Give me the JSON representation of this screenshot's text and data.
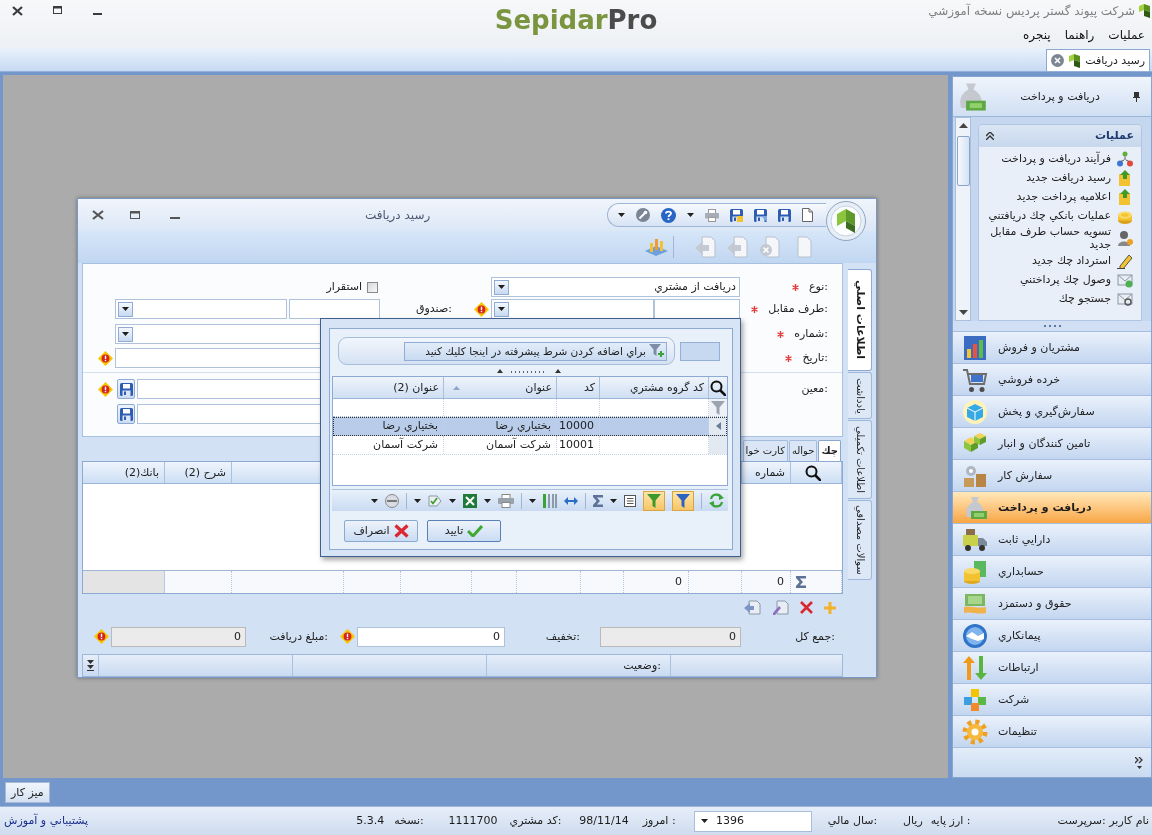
{
  "window": {
    "title": "شركت پيوند گستر پرديس نسخه آموزشي",
    "logo": {
      "text": "Sepidar",
      "suffix": "Pro"
    }
  },
  "menu": [
    {
      "label": "عمليات"
    },
    {
      "label": "راهنما"
    },
    {
      "label": "پنجره"
    }
  ],
  "document_tabs": [
    {
      "label": "رسيد دريافت",
      "selected": true
    }
  ],
  "dialog": {
    "title": "رسيد دريافت",
    "side_tabs": [
      {
        "label": "اطلاعات اصلي",
        "selected": true
      },
      {
        "label": "يادداشت",
        "selected": false
      },
      {
        "label": "اطلاعات تكميلي",
        "selected": false
      },
      {
        "label": "سوالات مصداقي",
        "selected": false
      }
    ],
    "form": {
      "type": {
        "label": "نوع:",
        "required": true,
        "value": "دريافت از مشتري"
      },
      "settled": {
        "label": "استقرار",
        "checked": false
      },
      "counterparty": {
        "label": "طرف مقابل:",
        "required": true,
        "warning": true
      },
      "cashbox": {
        "label": "صندوق:"
      },
      "number": {
        "label": "شماره:",
        "required": true
      },
      "date": {
        "label": "تاريخ:",
        "required": true,
        "warning": true
      },
      "ledger": {
        "label": "معين:",
        "warning": true
      }
    },
    "detail_tabs": [
      {
        "label": "چك",
        "selected": true
      },
      {
        "label": "حواله",
        "selected": false
      },
      {
        "label": "كارت خوا",
        "selected": false
      }
    ],
    "grid": {
      "headers": {
        "number": "شماره",
        "description": "شرح (2)",
        "bank": "بانك(2)"
      },
      "totals": {
        "number": "0",
        "column_4": "0"
      }
    },
    "summary": {
      "total": {
        "label": "جمع كل:",
        "value": "0",
        "readonly": true
      },
      "discount": {
        "label": "تخفيف:",
        "value": "0",
        "readonly": false,
        "warning": true
      },
      "received": {
        "label": "مبلغ دريافت:",
        "value": "0",
        "readonly": true,
        "warning": true
      }
    },
    "status_label": "وضعيت:",
    "lookup": {
      "filter_prompt": "براي اضافه كردن شرط پيشرفته در اينجا كليك كنيد",
      "columns": [
        {
          "label": "كد گروه مشتري",
          "sorted": false
        },
        {
          "label": "كد",
          "sorted": false
        },
        {
          "label": "عنوان",
          "sorted": true
        },
        {
          "label": "عنوان (2)",
          "sorted": false
        }
      ],
      "rows": [
        {
          "code": "10000",
          "title": "بختياري رضا",
          "title_2": "بختياري رضا",
          "selected": true
        },
        {
          "code": "10001",
          "title": "شركت آسمان",
          "title_2": "شركت آسمان",
          "selected": false
        }
      ],
      "toolbar": {
        "filter_row_on": true,
        "filter_on": true
      },
      "buttons": [
        {
          "kind": "ok",
          "label": "تاييد"
        },
        {
          "kind": "cancel",
          "label": "انصراف"
        }
      ]
    }
  },
  "sidebar": {
    "title": "دريافت و پرداخت",
    "task_group": {
      "title": "عمليات",
      "expanded": true,
      "items": [
        {
          "label": "فرآيند دريافت و پرداخت"
        },
        {
          "label": "رسيد دريافت جديد"
        },
        {
          "label": "اعلاميه پرداخت جديد"
        },
        {
          "label": "عمليات بانكي چك دريافتني"
        },
        {
          "label": "تسويه حساب طرف مقابل جديد"
        },
        {
          "label": "استرداد چك جديد"
        },
        {
          "label": "وصول چك پرداختني"
        },
        {
          "label": "جستجو چك"
        }
      ]
    },
    "modules": [
      {
        "label": "مشتريان و فروش",
        "selected": false
      },
      {
        "label": "خرده فروشي",
        "selected": false
      },
      {
        "label": "سفارش‌گيري و پخش",
        "selected": false
      },
      {
        "label": "تامين كنندگان و انبار",
        "selected": false
      },
      {
        "label": "سفارش كار",
        "selected": false
      },
      {
        "label": "دريافت و پرداخت",
        "selected": true
      },
      {
        "label": "دارايي ثابت",
        "selected": false
      },
      {
        "label": "حسابداري",
        "selected": false
      },
      {
        "label": "حقوق و دستمزد",
        "selected": false
      },
      {
        "label": "پيمانكاري",
        "selected": false
      },
      {
        "label": "ارتباطات",
        "selected": false
      },
      {
        "label": "شركت",
        "selected": false
      },
      {
        "label": "تنظيمات",
        "selected": false
      }
    ]
  },
  "taskbar": [
    {
      "label": "ميز كار"
    }
  ],
  "status_bar": {
    "user": "نام كاربر :سرپرست",
    "currency": {
      "label": "ارز پايه :",
      "value": "ريال"
    },
    "fiscal_year": {
      "label": "سال مالي:",
      "value": "1396"
    },
    "today": {
      "label": "امروز :",
      "value": "98/11/14"
    },
    "customer_code": {
      "label": "كد مشتري:",
      "value": "1111700"
    },
    "version": {
      "label": "نسخه:",
      "value": "5.3.4"
    },
    "support_link": "پشتيباني و آموزش"
  }
}
